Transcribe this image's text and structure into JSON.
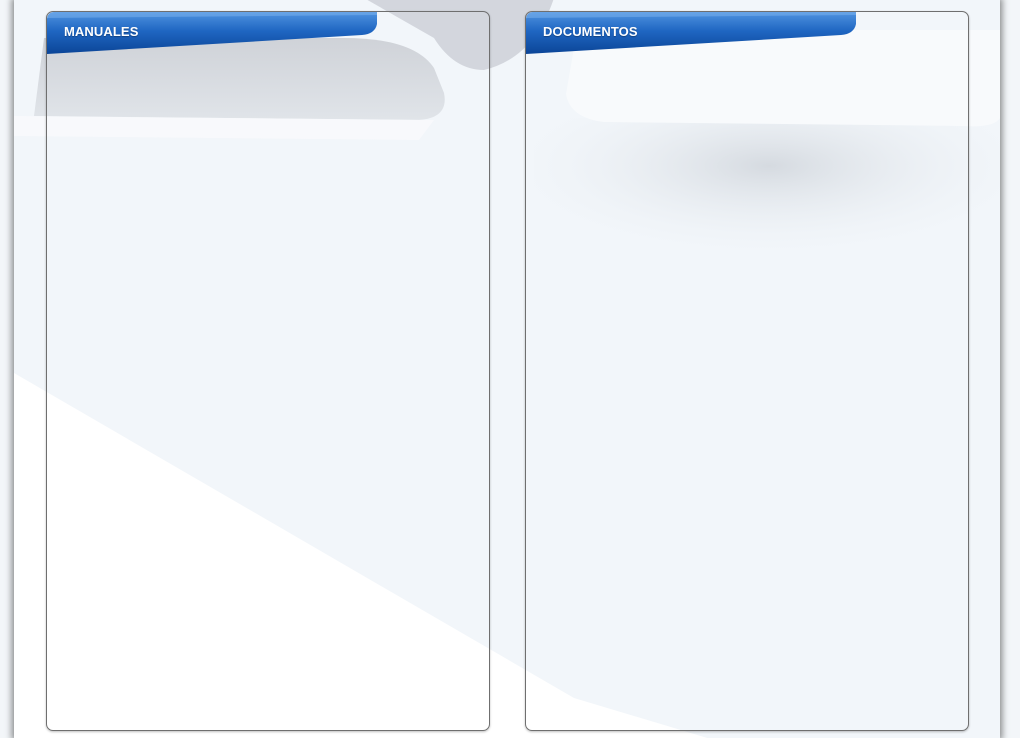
{
  "panels": {
    "left": {
      "title": "MANUALES"
    },
    "right": {
      "title": "DOCUMENTOS"
    }
  },
  "colors": {
    "header_blue_light": "#3f84d6",
    "header_blue_dark": "#0c4a9e",
    "background": "#f2f6fa",
    "panel_border": "#6f6f6f"
  }
}
